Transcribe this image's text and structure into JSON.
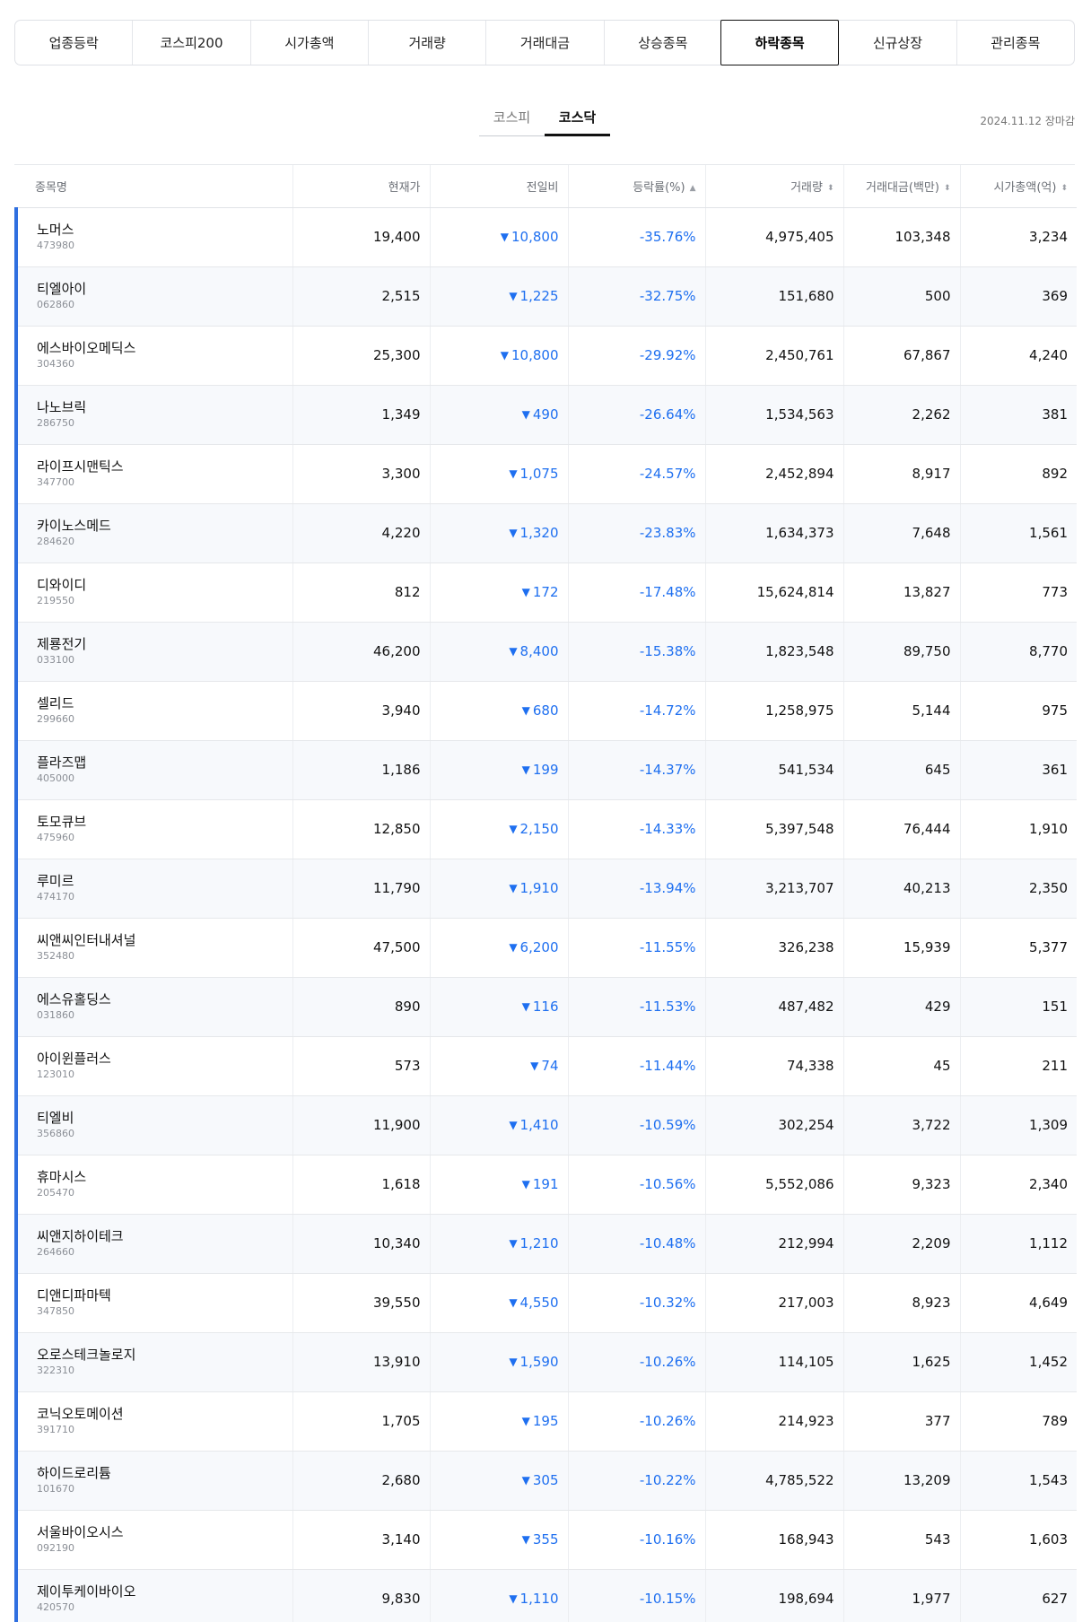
{
  "category_tabs": [
    {
      "label": "업종등락",
      "active": false
    },
    {
      "label": "코스피200",
      "active": false
    },
    {
      "label": "시가총액",
      "active": false
    },
    {
      "label": "거래량",
      "active": false
    },
    {
      "label": "거래대금",
      "active": false
    },
    {
      "label": "상승종목",
      "active": false
    },
    {
      "label": "하락종목",
      "active": true
    },
    {
      "label": "신규상장",
      "active": false
    },
    {
      "label": "관리종목",
      "active": false
    }
  ],
  "market_tabs": [
    {
      "label": "코스피",
      "active": false
    },
    {
      "label": "코스닥",
      "active": true
    }
  ],
  "date_info": "2024.11.12 장마감",
  "table": {
    "headers": {
      "name": "종목명",
      "price": "현재가",
      "change": "전일비",
      "rate": "등락률(%)",
      "volume": "거래량",
      "amount": "거래대금(백만)",
      "market_cap": "시가총액(억)"
    },
    "rows": [
      {
        "name": "노머스",
        "code": "473980",
        "price": "19,400",
        "change": "10,800",
        "rate": "-35.76%",
        "volume": "4,975,405",
        "amount": "103,348",
        "market_cap": "3,234"
      },
      {
        "name": "티엘아이",
        "code": "062860",
        "price": "2,515",
        "change": "1,225",
        "rate": "-32.75%",
        "volume": "151,680",
        "amount": "500",
        "market_cap": "369"
      },
      {
        "name": "에스바이오메딕스",
        "code": "304360",
        "price": "25,300",
        "change": "10,800",
        "rate": "-29.92%",
        "volume": "2,450,761",
        "amount": "67,867",
        "market_cap": "4,240"
      },
      {
        "name": "나노브릭",
        "code": "286750",
        "price": "1,349",
        "change": "490",
        "rate": "-26.64%",
        "volume": "1,534,563",
        "amount": "2,262",
        "market_cap": "381"
      },
      {
        "name": "라이프시맨틱스",
        "code": "347700",
        "price": "3,300",
        "change": "1,075",
        "rate": "-24.57%",
        "volume": "2,452,894",
        "amount": "8,917",
        "market_cap": "892"
      },
      {
        "name": "카이노스메드",
        "code": "284620",
        "price": "4,220",
        "change": "1,320",
        "rate": "-23.83%",
        "volume": "1,634,373",
        "amount": "7,648",
        "market_cap": "1,561"
      },
      {
        "name": "디와이디",
        "code": "219550",
        "price": "812",
        "change": "172",
        "rate": "-17.48%",
        "volume": "15,624,814",
        "amount": "13,827",
        "market_cap": "773"
      },
      {
        "name": "제룡전기",
        "code": "033100",
        "price": "46,200",
        "change": "8,400",
        "rate": "-15.38%",
        "volume": "1,823,548",
        "amount": "89,750",
        "market_cap": "8,770"
      },
      {
        "name": "셀리드",
        "code": "299660",
        "price": "3,940",
        "change": "680",
        "rate": "-14.72%",
        "volume": "1,258,975",
        "amount": "5,144",
        "market_cap": "975"
      },
      {
        "name": "플라즈맵",
        "code": "405000",
        "price": "1,186",
        "change": "199",
        "rate": "-14.37%",
        "volume": "541,534",
        "amount": "645",
        "market_cap": "361"
      },
      {
        "name": "토모큐브",
        "code": "475960",
        "price": "12,850",
        "change": "2,150",
        "rate": "-14.33%",
        "volume": "5,397,548",
        "amount": "76,444",
        "market_cap": "1,910"
      },
      {
        "name": "루미르",
        "code": "474170",
        "price": "11,790",
        "change": "1,910",
        "rate": "-13.94%",
        "volume": "3,213,707",
        "amount": "40,213",
        "market_cap": "2,350"
      },
      {
        "name": "씨앤씨인터내셔널",
        "code": "352480",
        "price": "47,500",
        "change": "6,200",
        "rate": "-11.55%",
        "volume": "326,238",
        "amount": "15,939",
        "market_cap": "5,377"
      },
      {
        "name": "에스유홀딩스",
        "code": "031860",
        "price": "890",
        "change": "116",
        "rate": "-11.53%",
        "volume": "487,482",
        "amount": "429",
        "market_cap": "151"
      },
      {
        "name": "아이윈플러스",
        "code": "123010",
        "price": "573",
        "change": "74",
        "rate": "-11.44%",
        "volume": "74,338",
        "amount": "45",
        "market_cap": "211"
      },
      {
        "name": "티엘비",
        "code": "356860",
        "price": "11,900",
        "change": "1,410",
        "rate": "-10.59%",
        "volume": "302,254",
        "amount": "3,722",
        "market_cap": "1,309"
      },
      {
        "name": "휴마시스",
        "code": "205470",
        "price": "1,618",
        "change": "191",
        "rate": "-10.56%",
        "volume": "5,552,086",
        "amount": "9,323",
        "market_cap": "2,340"
      },
      {
        "name": "씨앤지하이테크",
        "code": "264660",
        "price": "10,340",
        "change": "1,210",
        "rate": "-10.48%",
        "volume": "212,994",
        "amount": "2,209",
        "market_cap": "1,112"
      },
      {
        "name": "디앤디파마텍",
        "code": "347850",
        "price": "39,550",
        "change": "4,550",
        "rate": "-10.32%",
        "volume": "217,003",
        "amount": "8,923",
        "market_cap": "4,649"
      },
      {
        "name": "오로스테크놀로지",
        "code": "322310",
        "price": "13,910",
        "change": "1,590",
        "rate": "-10.26%",
        "volume": "114,105",
        "amount": "1,625",
        "market_cap": "1,452"
      },
      {
        "name": "코닉오토메이션",
        "code": "391710",
        "price": "1,705",
        "change": "195",
        "rate": "-10.26%",
        "volume": "214,923",
        "amount": "377",
        "market_cap": "789"
      },
      {
        "name": "하이드로리튬",
        "code": "101670",
        "price": "2,680",
        "change": "305",
        "rate": "-10.22%",
        "volume": "4,785,522",
        "amount": "13,209",
        "market_cap": "1,543"
      },
      {
        "name": "서울바이오시스",
        "code": "092190",
        "price": "3,140",
        "change": "355",
        "rate": "-10.16%",
        "volume": "168,943",
        "amount": "543",
        "market_cap": "1,603"
      },
      {
        "name": "제이투케이바이오",
        "code": "420570",
        "price": "9,830",
        "change": "1,110",
        "rate": "-10.15%",
        "volume": "198,694",
        "amount": "1,977",
        "market_cap": "627"
      }
    ]
  },
  "colors": {
    "down": "#1e6ff0",
    "row_marker": "#2f6fe0"
  },
  "icons": {
    "sort_both": "sort-updown-icon",
    "sort_asc": "sort-up-icon",
    "down_arrow": "triangle-down-icon"
  }
}
